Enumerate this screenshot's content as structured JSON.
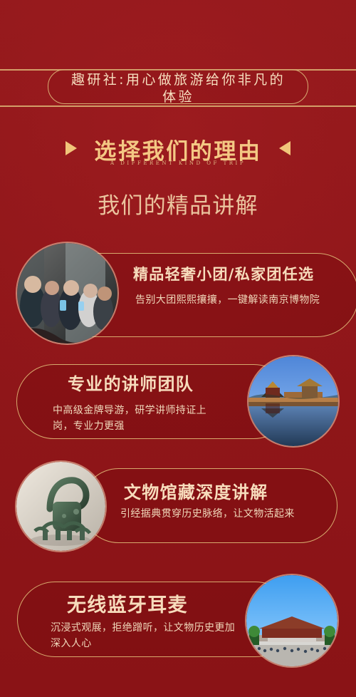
{
  "header": {
    "text": "趣研社:用心做旅游给你非凡的体验"
  },
  "reason": {
    "title": "选择我们的理由",
    "subtitle": "A DIFFERENT KIND OF TRIP"
  },
  "section_title": "我们的精品讲解",
  "features": [
    {
      "title": "精品轻奢小团/私家团任选",
      "desc": "告别大团熙熙攘攘，一键解读南京博物院"
    },
    {
      "title": "专业的讲师团队",
      "desc": "中高级金牌导游，研学讲师持证上岗，专业力更强"
    },
    {
      "title": "文物馆藏深度讲解",
      "desc": "引经据典贯穿历史脉络，让文物活起来"
    },
    {
      "title": "无线蓝牙耳麦",
      "desc": "沉浸式观展，拒绝蹭听，让文物历史更加深入人心"
    }
  ]
}
